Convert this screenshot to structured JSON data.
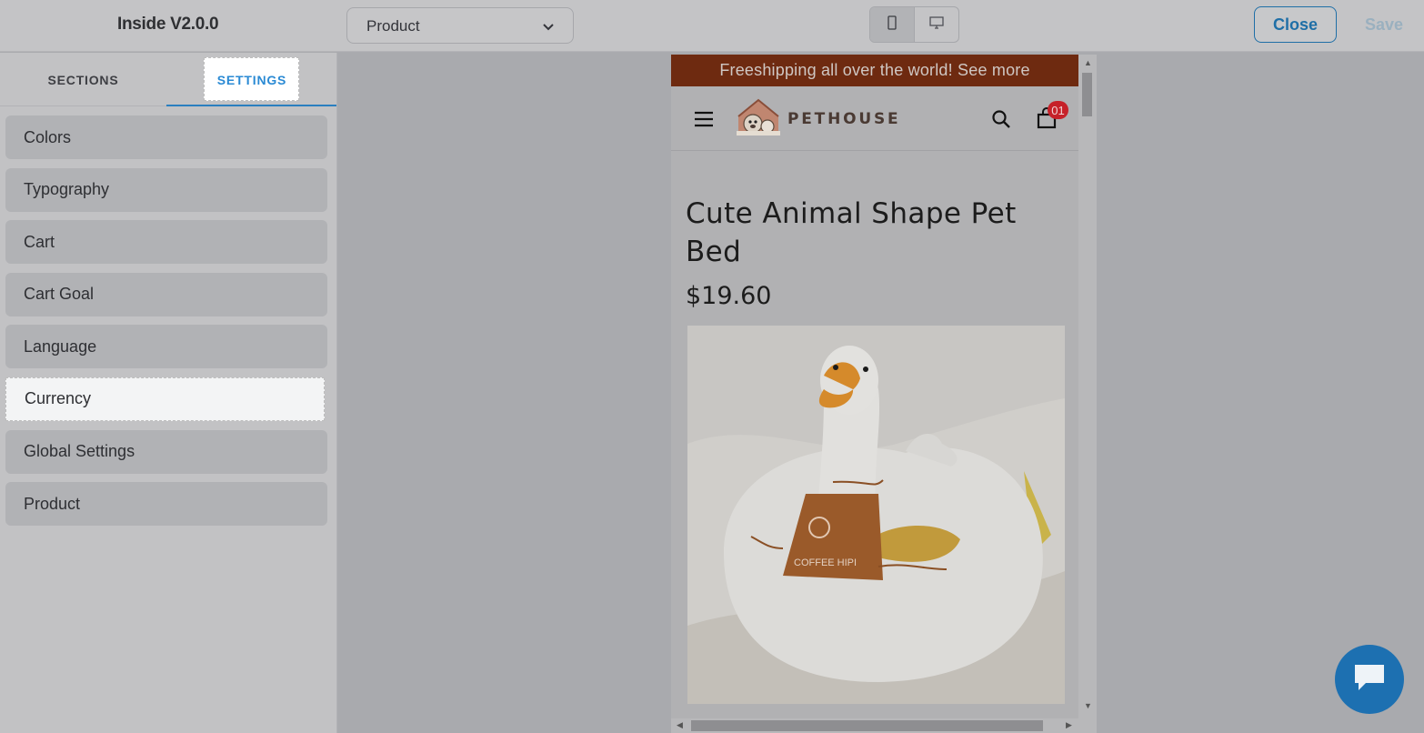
{
  "header": {
    "app_title": "Inside V2.0.0",
    "page_select": {
      "value": "Product"
    },
    "device_toggle": {
      "options": [
        "mobile",
        "desktop"
      ],
      "active": "mobile"
    },
    "close_label": "Close",
    "save_label": "Save"
  },
  "sidebar": {
    "tabs": [
      {
        "label": "SECTIONS",
        "active": false
      },
      {
        "label": "SETTINGS",
        "active": true
      }
    ],
    "items": [
      {
        "label": "Colors"
      },
      {
        "label": "Typography"
      },
      {
        "label": "Cart"
      },
      {
        "label": "Cart Goal"
      },
      {
        "label": "Language"
      },
      {
        "label": "Currency",
        "selected": true
      },
      {
        "label": "Global Settings"
      },
      {
        "label": "Product"
      }
    ]
  },
  "preview": {
    "announcement": "Freeshipping all over the world! See more",
    "brand": "PETHOUSE",
    "cart_count": "01",
    "product": {
      "title": "Cute Animal Shape Pet Bed",
      "price": "$19.60",
      "image_apron_text": "COFFEE HIPI"
    }
  },
  "colors": {
    "accent": "#2a7fc0",
    "announcement_bg": "#6e2a10",
    "badge": "#c62129",
    "chat_button": "#1d70b1"
  },
  "icons": [
    "chevron-down-icon",
    "mobile-icon",
    "desktop-icon",
    "hamburger-icon",
    "search-icon",
    "cart-icon",
    "chat-icon"
  ]
}
